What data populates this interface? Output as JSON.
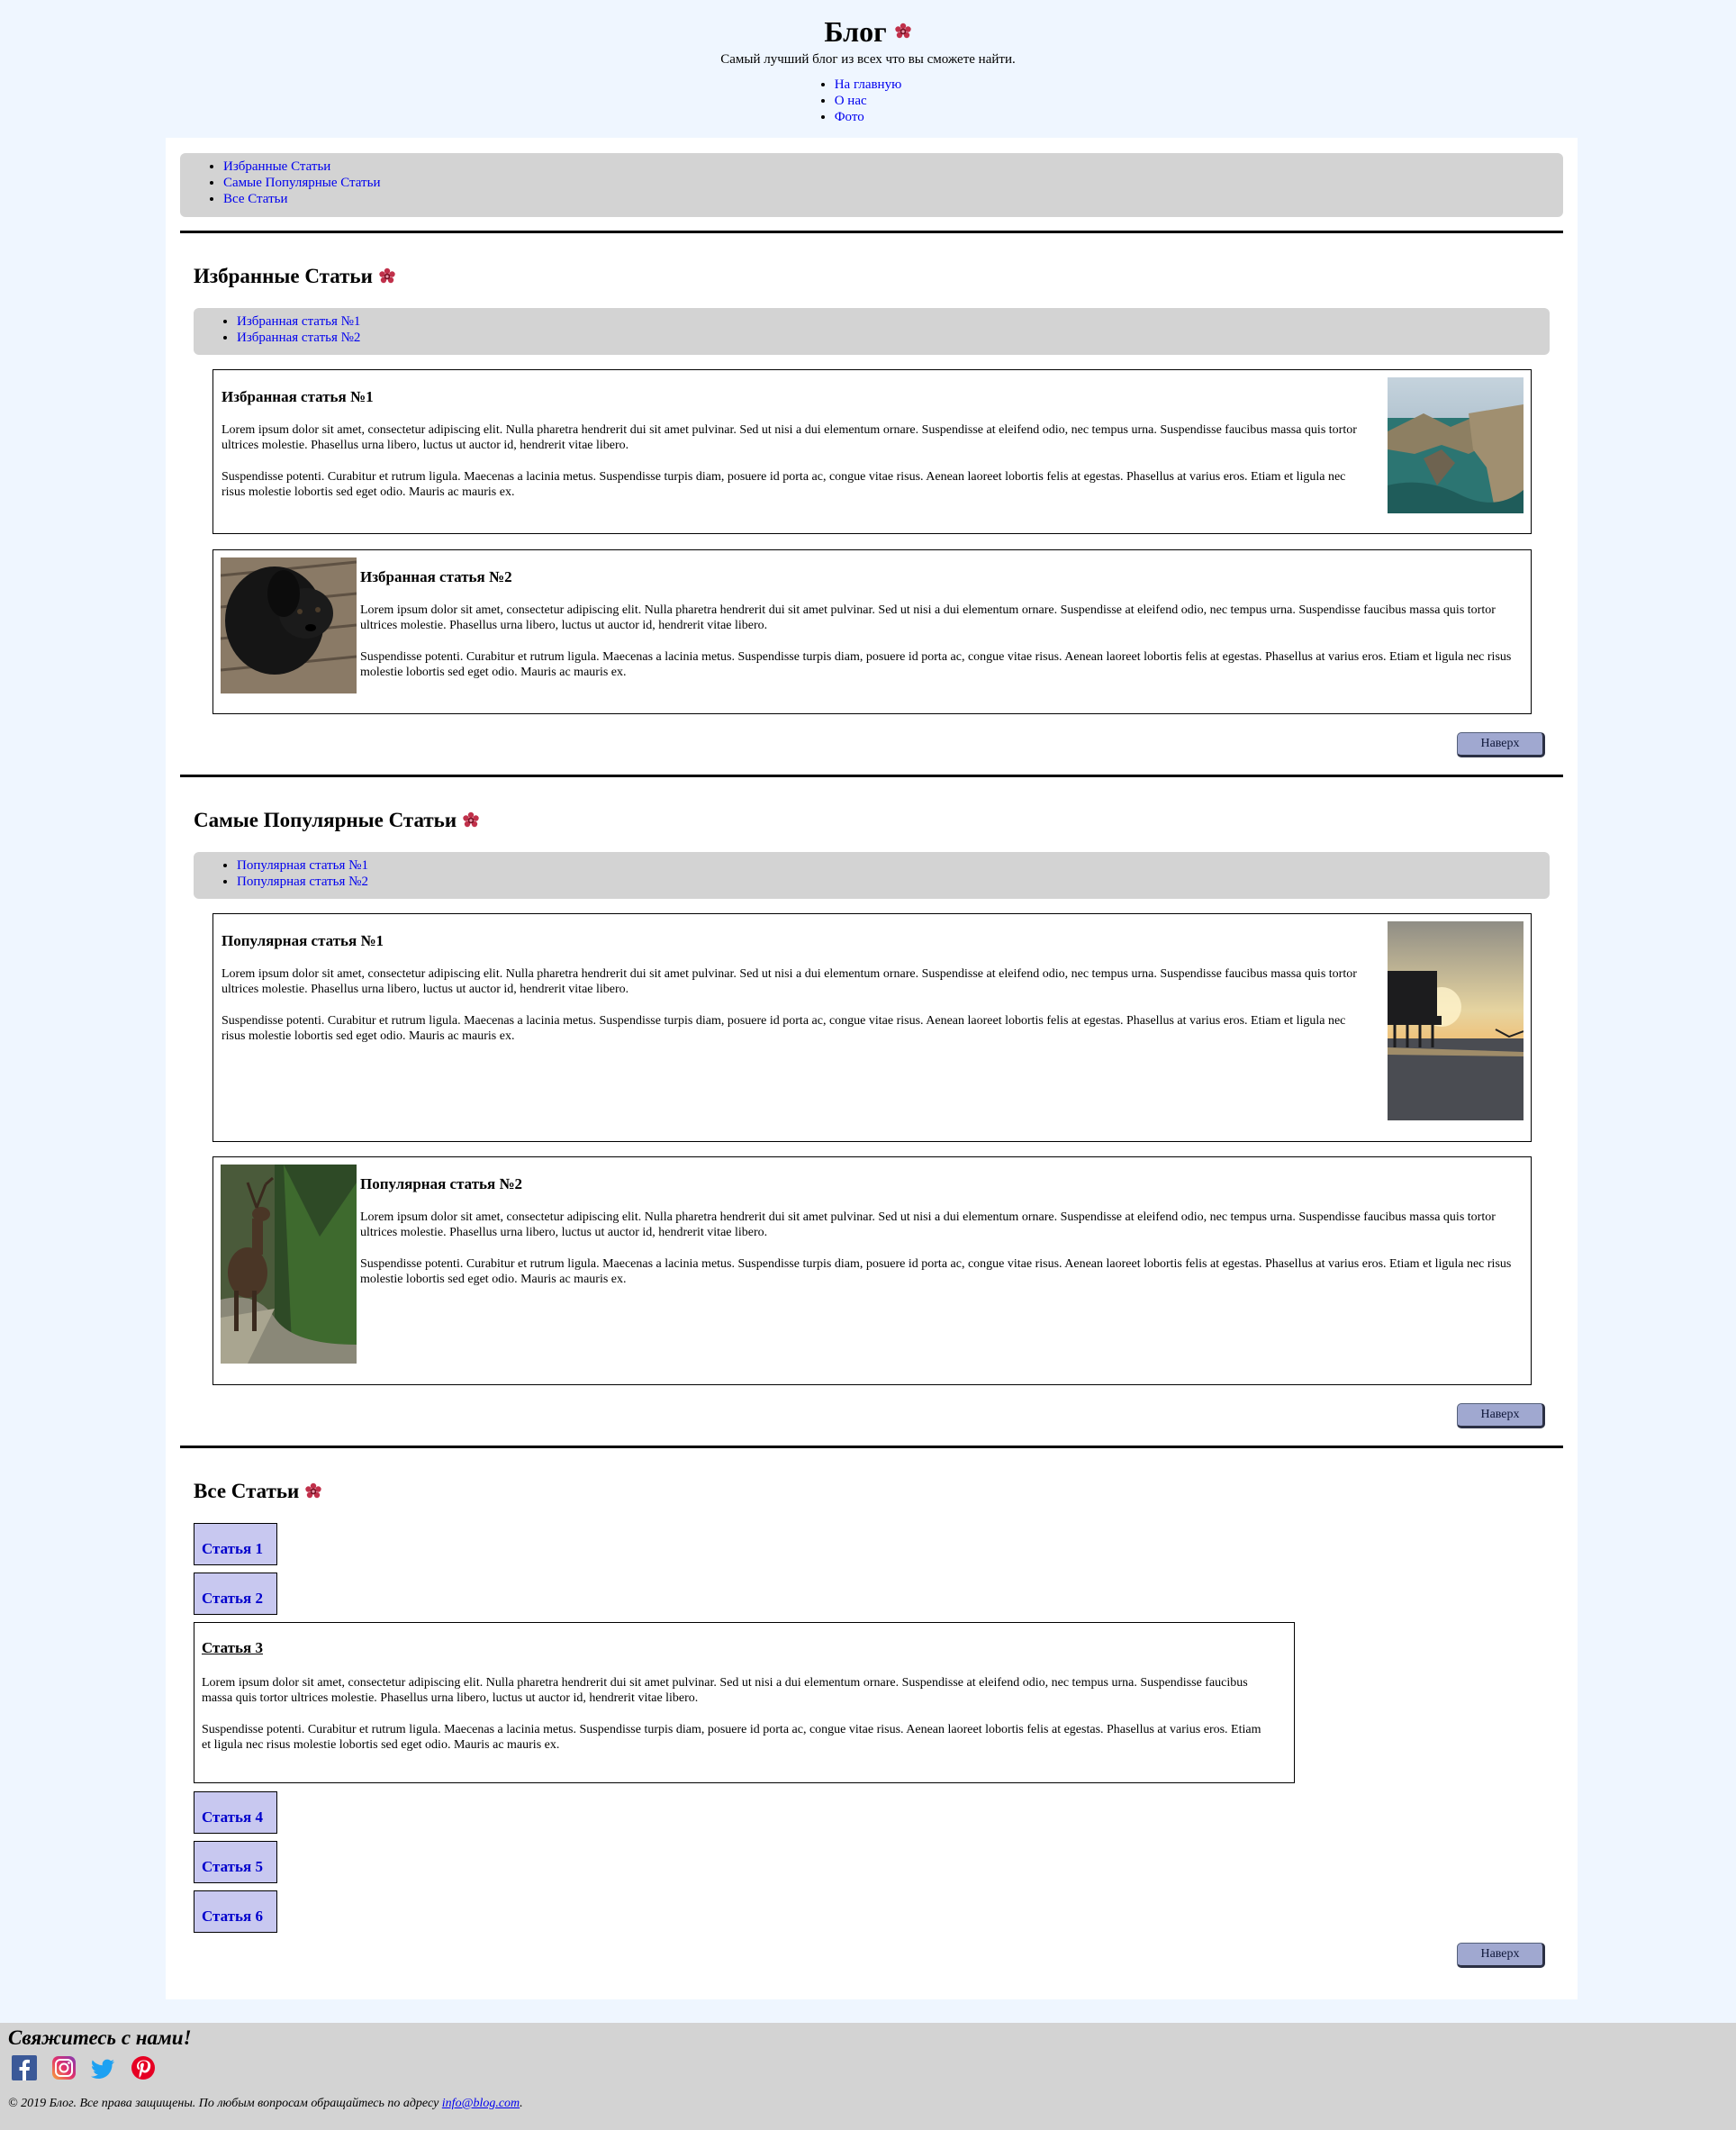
{
  "header": {
    "title": "Блог",
    "subtitle": "Самый лучший блог из всех что вы сможете найти.",
    "nav": [
      "На главную",
      "О нас",
      "Фото"
    ]
  },
  "section_nav": [
    "Избранные Статьи",
    "Самые Популярные Статьи",
    "Все Статьи"
  ],
  "featured": {
    "title": "Избранные Статьи",
    "nav": [
      "Избранная статья №1",
      "Избранная статья №2"
    ],
    "articles": [
      {
        "title": "Избранная статья №1",
        "p1": "Lorem ipsum dolor sit amet, consectetur adipiscing elit. Nulla pharetra hendrerit dui sit amet pulvinar. Sed ut nisi a dui elementum ornare. Suspendisse at eleifend odio, nec tempus urna. Suspendisse faucibus massa quis tortor ultrices molestie. Phasellus urna libero, luctus ut auctor id, hendrerit vitae libero.",
        "p2": "Suspendisse potenti. Curabitur et rutrum ligula. Maecenas a lacinia metus. Suspendisse turpis diam, posuere id porta ac, congue vitae risus. Aenean laoreet lobortis felis at egestas. Phasellus at varius eros. Etiam et ligula nec risus molestie lobortis sed eget odio. Mauris ac mauris ex."
      },
      {
        "title": "Избранная статья №2",
        "p1": "Lorem ipsum dolor sit amet, consectetur adipiscing elit. Nulla pharetra hendrerit dui sit amet pulvinar. Sed ut nisi a dui elementum ornare. Suspendisse at eleifend odio, nec tempus urna. Suspendisse faucibus massa quis tortor ultrices molestie. Phasellus urna libero, luctus ut auctor id, hendrerit vitae libero.",
        "p2": "Suspendisse potenti. Curabitur et rutrum ligula. Maecenas a lacinia metus. Suspendisse turpis diam, posuere id porta ac, congue vitae risus. Aenean laoreet lobortis felis at egestas. Phasellus at varius eros. Etiam et ligula nec risus molestie lobortis sed eget odio. Mauris ac mauris ex."
      }
    ]
  },
  "popular": {
    "title": "Самые Популярные Статьи",
    "nav": [
      "Популярная статья №1",
      "Популярная статья №2"
    ],
    "articles": [
      {
        "title": "Популярная статья №1",
        "p1": "Lorem ipsum dolor sit amet, consectetur adipiscing elit. Nulla pharetra hendrerit dui sit amet pulvinar. Sed ut nisi a dui elementum ornare. Suspendisse at eleifend odio, nec tempus urna. Suspendisse faucibus massa quis tortor ultrices molestie. Phasellus urna libero, luctus ut auctor id, hendrerit vitae libero.",
        "p2": "Suspendisse potenti. Curabitur et rutrum ligula. Maecenas a lacinia metus. Suspendisse turpis diam, posuere id porta ac, congue vitae risus. Aenean laoreet lobortis felis at egestas. Phasellus at varius eros. Etiam et ligula nec risus molestie lobortis sed eget odio. Mauris ac mauris ex."
      },
      {
        "title": "Популярная статья №2",
        "p1": "Lorem ipsum dolor sit amet, consectetur adipiscing elit. Nulla pharetra hendrerit dui sit amet pulvinar. Sed ut nisi a dui elementum ornare. Suspendisse at eleifend odio, nec tempus urna. Suspendisse faucibus massa quis tortor ultrices molestie. Phasellus urna libero, luctus ut auctor id, hendrerit vitae libero.",
        "p2": "Suspendisse potenti. Curabitur et rutrum ligula. Maecenas a lacinia metus. Suspendisse turpis diam, posuere id porta ac, congue vitae risus. Aenean laoreet lobortis felis at egestas. Phasellus at varius eros. Etiam et ligula nec risus molestie lobortis sed eget odio. Mauris ac mauris ex."
      }
    ]
  },
  "all": {
    "title": "Все Статьи",
    "items": [
      "Статья 1",
      "Статья 2",
      "Статья 3",
      "Статья 4",
      "Статья 5",
      "Статья 6"
    ],
    "open_article": {
      "title": "Статья 3",
      "p1": "Lorem ipsum dolor sit amet, consectetur adipiscing elit. Nulla pharetra hendrerit dui sit amet pulvinar. Sed ut nisi a dui elementum ornare. Suspendisse at eleifend odio, nec tempus urna. Suspendisse faucibus massa quis tortor ultrices molestie. Phasellus urna libero, luctus ut auctor id, hendrerit vitae libero.",
      "p2": "Suspendisse potenti. Curabitur et rutrum ligula. Maecenas a lacinia metus. Suspendisse turpis diam, posuere id porta ac, congue vitae risus. Aenean laoreet lobortis felis at egestas. Phasellus at varius eros. Etiam et ligula nec risus molestie lobortis sed eget odio. Mauris ac mauris ex."
    }
  },
  "top_button": "Наверх",
  "footer": {
    "title": "Свяжитесь с нами!",
    "social": [
      "facebook-icon",
      "instagram-icon",
      "twitter-icon",
      "pinterest-icon"
    ],
    "copyright": "© 2019 Блог. Все права защищены. По любым вопросам обращайтесь по адресу ",
    "email": "info@blog.com",
    "period": "."
  },
  "colors": {
    "page_bg": "#eff6ff",
    "nav_bg": "#d3d3d3",
    "button_bg": "#a0a8d0",
    "accordion_bg": "#c8c8f0"
  }
}
